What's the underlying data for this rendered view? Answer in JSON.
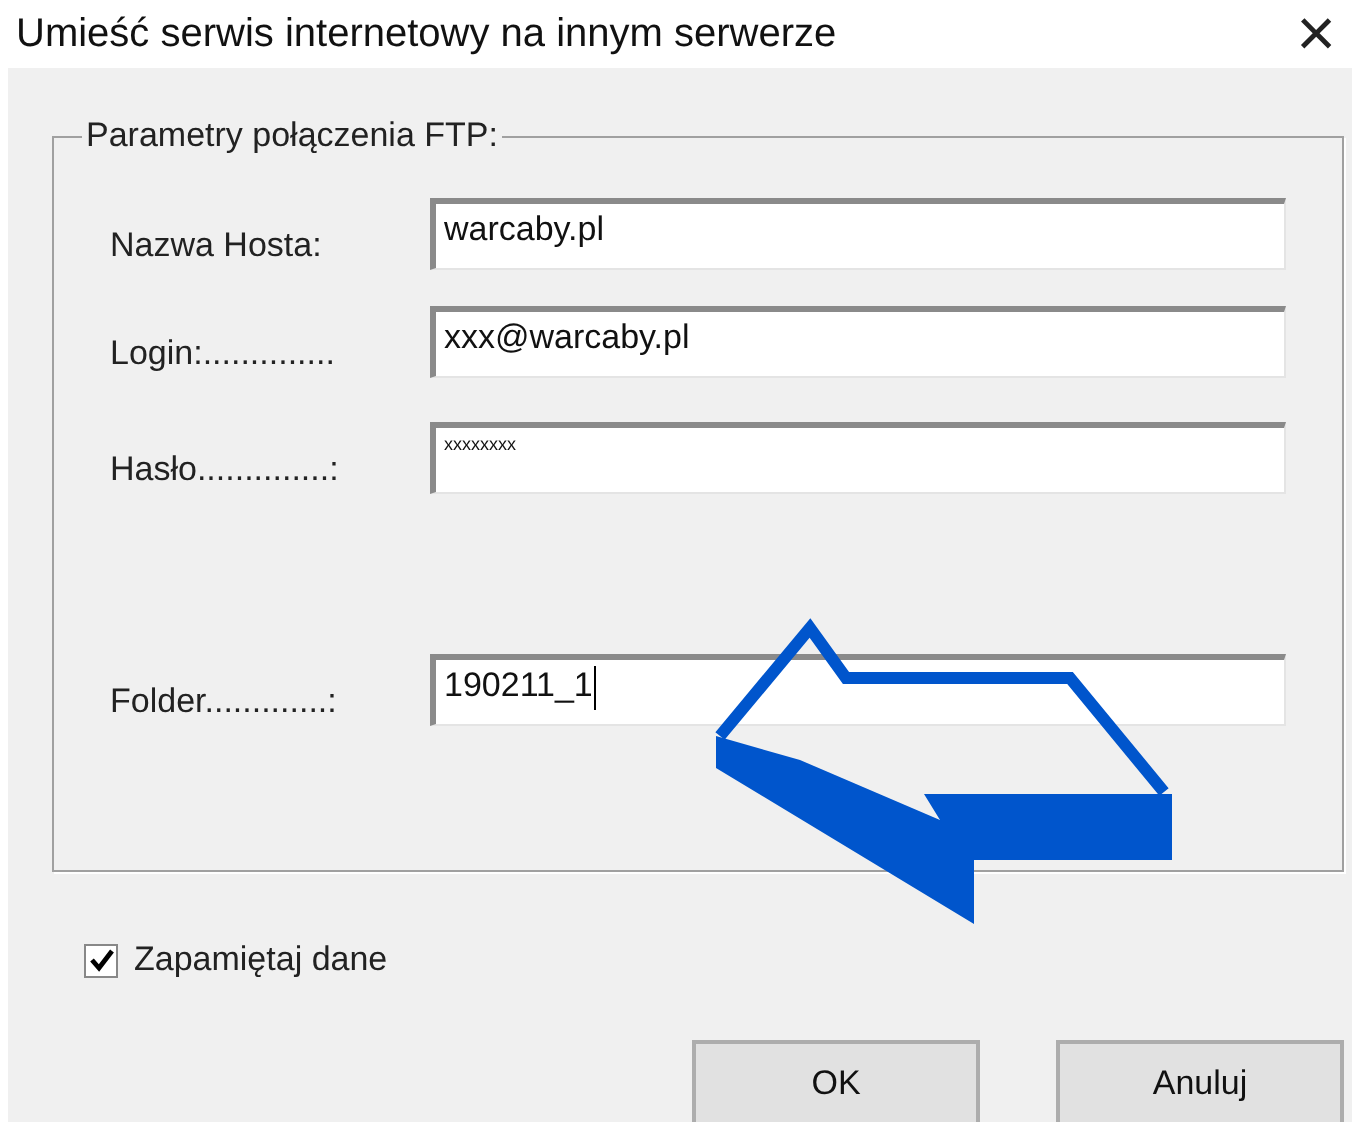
{
  "window": {
    "title": "Umieść serwis internetowy na innym serwerze",
    "close": "×"
  },
  "group": {
    "title": "Parametry połączenia FTP:",
    "fields": [
      {
        "label": "Nazwa Hosta:",
        "value": "warcaby.pl",
        "kind": "text",
        "focused": false
      },
      {
        "label": "Login:..............",
        "value": "xxx@warcaby.pl",
        "kind": "text",
        "focused": false
      },
      {
        "label": "Hasło..............:",
        "value": "xxxxxxxx",
        "kind": "password",
        "focused": false
      },
      {
        "label": "Folder.............:",
        "value": "190211_1",
        "kind": "text",
        "focused": true
      }
    ]
  },
  "remember": {
    "label": "Zapamiętaj dane",
    "checked": true
  },
  "buttons": [
    "OK",
    "Anuluj"
  ]
}
